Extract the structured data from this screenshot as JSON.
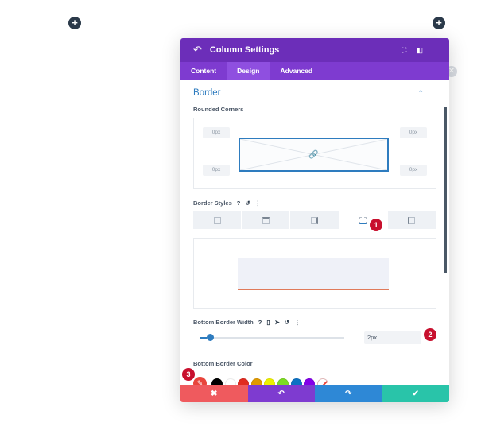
{
  "canvas": {
    "add_glyph": "+"
  },
  "modal": {
    "title": "Column Settings",
    "icons": {
      "back": "back-arrow-icon",
      "expand": "expand-icon",
      "split": "split-view-icon",
      "more": "more-icon"
    },
    "tabs": [
      {
        "label": "Content",
        "active": false
      },
      {
        "label": "Design",
        "active": true
      },
      {
        "label": "Advanced",
        "active": false
      }
    ]
  },
  "border": {
    "section_title": "Border",
    "rounded_corners_label": "Rounded Corners",
    "corners": {
      "top_left": "0px",
      "top_right": "0px",
      "bottom_left": "0px",
      "bottom_right": "0px"
    },
    "styles_label": "Border Styles",
    "style_options": [
      "all",
      "top",
      "right",
      "bottom",
      "left"
    ],
    "active_style": "bottom",
    "width_label": "Bottom Border Width",
    "width_value": "2px",
    "width_slider_fraction": 0.05,
    "color_label": "Bottom Border Color",
    "swatches": [
      "#000000",
      "#ffffff",
      "#e02b20",
      "#e09900",
      "#edf000",
      "#7cda24",
      "#0c71c3",
      "#8300e9"
    ]
  },
  "footer": {
    "cancel_glyph": "✖",
    "undo_glyph": "↶",
    "redo_glyph": "↷",
    "save_glyph": "✔",
    "colors": {
      "cancel": "#ef5a5e",
      "undo": "#7e3bd0",
      "redo": "#2e88d6",
      "save": "#29c4a9"
    }
  },
  "markers": [
    "1",
    "2",
    "3"
  ],
  "colors": {
    "header": "#6c2eb9",
    "tabs": "#7e3bd0",
    "accent": "#2e7cbf",
    "marker": "#c8102e"
  }
}
